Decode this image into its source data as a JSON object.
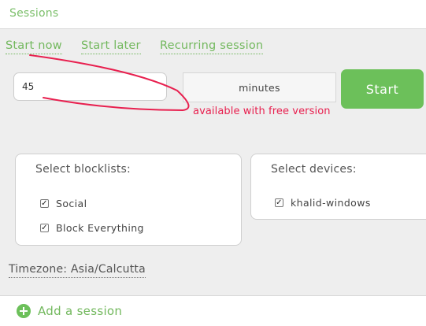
{
  "header": {
    "title": "Sessions"
  },
  "tabs": [
    {
      "label": "Start now"
    },
    {
      "label": "Start later"
    },
    {
      "label": "Recurring session"
    }
  ],
  "duration": {
    "value": "45",
    "unit": "minutes"
  },
  "start_button": {
    "label": "Start"
  },
  "annotation": {
    "text": "available with free version",
    "color": "#e8204f"
  },
  "blocklists": {
    "title": "Select blocklists:",
    "items": [
      {
        "label": "Social",
        "checked": true
      },
      {
        "label": "Block Everything",
        "checked": true
      }
    ]
  },
  "devices": {
    "title": "Select devices:",
    "items": [
      {
        "label": "khalid-windows",
        "checked": true
      }
    ]
  },
  "timezone": {
    "label": "Timezone: Asia/Calcutta"
  },
  "footer": {
    "add_label": "Add a session"
  },
  "colors": {
    "accent": "#6cc05a",
    "link": "#72b85d",
    "annotation": "#e8204f"
  }
}
